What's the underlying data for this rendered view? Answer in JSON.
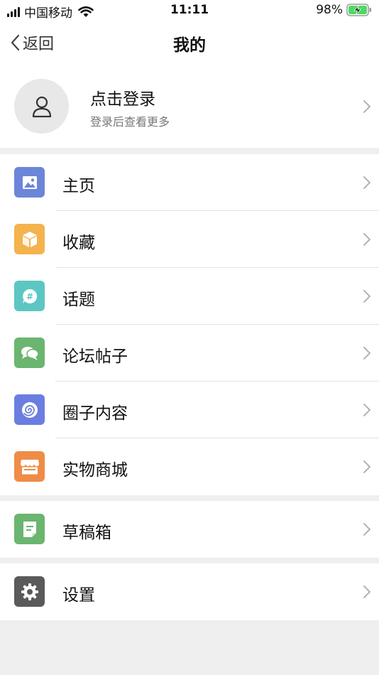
{
  "status_bar": {
    "carrier": "中国移动",
    "time": "11:11",
    "battery": "98%"
  },
  "nav": {
    "back_label": "返回",
    "title": "我的"
  },
  "profile": {
    "title": "点击登录",
    "subtitle": "登录后查看更多"
  },
  "menu": [
    {
      "label": "主页",
      "icon": "image-icon",
      "color": "#6b85d9"
    },
    {
      "label": "收藏",
      "icon": "box-icon",
      "color": "#f4b34d"
    },
    {
      "label": "话题",
      "icon": "hashtag-bubble-icon",
      "color": "#5cc7c2"
    },
    {
      "label": "论坛帖子",
      "icon": "chat-bubbles-icon",
      "color": "#6ab56f"
    },
    {
      "label": "圈子内容",
      "icon": "spiral-icon",
      "color": "#6b7ee0"
    },
    {
      "label": "实物商城",
      "icon": "shop-icon",
      "color": "#ef8c47"
    }
  ],
  "drafts": {
    "label": "草稿箱",
    "icon": "document-icon",
    "color": "#6ab56f"
  },
  "settings": {
    "label": "设置",
    "icon": "gear-icon",
    "color": "#5a5a5a"
  }
}
